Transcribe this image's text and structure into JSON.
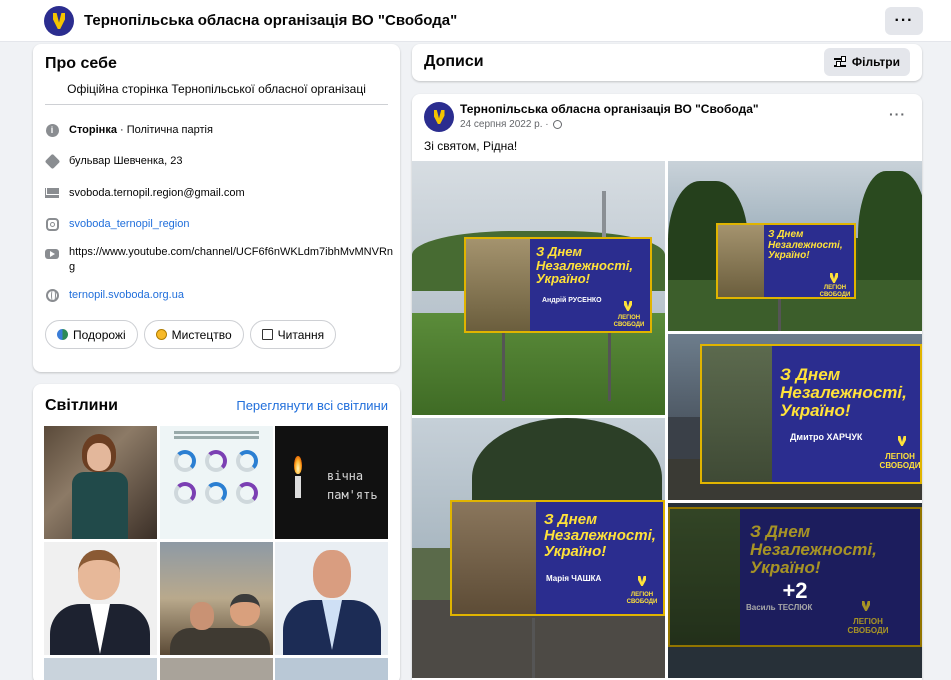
{
  "header": {
    "page_name": "Тернопільська обласна організація ВО \"Свобода\"",
    "more_label": "···"
  },
  "about": {
    "title": "Про себе",
    "description": "Офіційна сторінка Тернопільської обласної організаці",
    "category_prefix": "Сторінка",
    "category": " · Політична партія",
    "address": "бульвар Шевченка, 23",
    "email": "svoboda.ternopil.region@gmail.com",
    "instagram": "svoboda_ternopil_region",
    "youtube": "https://www.youtube.com/channel/UCF6f6nWKLdm7ibhMvMNVRng",
    "website": "ternopil.svoboda.org.ua",
    "chips": [
      {
        "label": "Подорожі",
        "icon": "travel-icon"
      },
      {
        "label": "Мистецтво",
        "icon": "palette-icon"
      },
      {
        "label": "Читання",
        "icon": "book-icon"
      }
    ]
  },
  "photos": {
    "title": "Світлини",
    "see_all": "Переглянути всі світлини",
    "tile_texts": {
      "memorial_line1": "вічна",
      "memorial_line2": "пам'ять"
    }
  },
  "posts": {
    "title": "Дописи",
    "filter_label": "Фільтри"
  },
  "post": {
    "author": "Тернопільська обласна організація ВО \"Свобода\"",
    "date": "24 серпня 2022 р. ·",
    "text": "Зі святом, Рідна!",
    "more_label": "···",
    "billboard_line1": "З Днем",
    "billboard_line2": "Незалежності,",
    "billboard_line3": "Україно!",
    "billboard_logo": "ЛЕГІОН СВОБОДИ",
    "names": [
      "Андрій РУСЕНКО",
      "Дмитро ХАРЧУК",
      "Марія ЧАШКА",
      "Василь ТЕСЛЮК"
    ],
    "extra_count": "+2"
  },
  "colors": {
    "accent": "#216fdb",
    "party_blue": "#2b2d8f",
    "party_yellow": "#f4c400"
  }
}
